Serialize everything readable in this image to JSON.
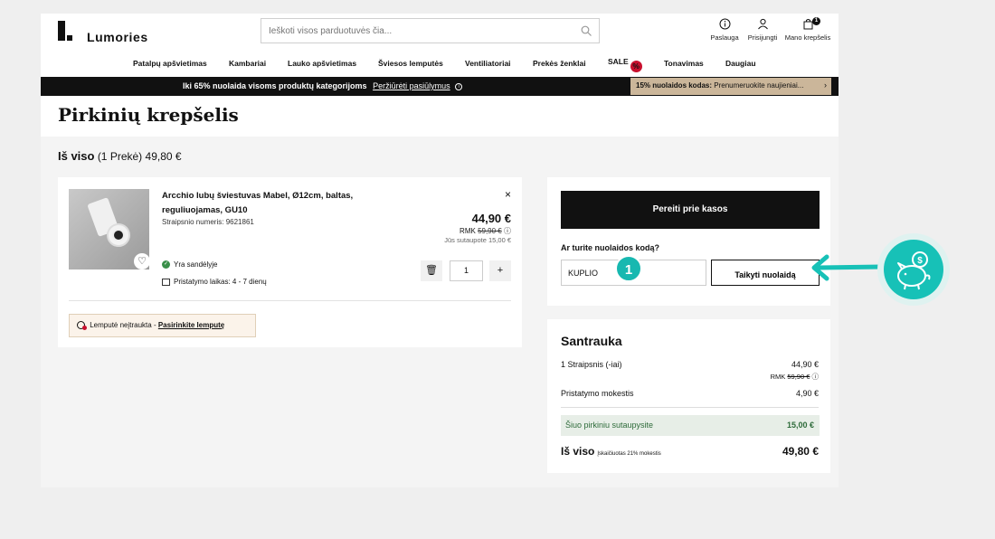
{
  "header": {
    "logo": "Lumories",
    "search_placeholder": "Ieškoti visos parduotuvės čia...",
    "icons": [
      {
        "name": "info-icon",
        "label": "Paslauga"
      },
      {
        "name": "user-icon",
        "label": "Prisijungti"
      },
      {
        "name": "bag-icon",
        "label": "Mano krepšelis",
        "badge": "1"
      }
    ]
  },
  "nav": [
    "Patalpų apšvietimas",
    "Kambariai",
    "Lauko apšvietimas",
    "Šviesos lemputės",
    "Ventiliatoriai",
    "Prekės ženklai",
    "SALE",
    "Tonavimas",
    "Daugiau"
  ],
  "sale_badge": "%",
  "promo": {
    "message": "Iki 65% nuolaida visoms produktų kategorijoms",
    "link": "Peržiūrėti pasiūlymus",
    "code_label": "15% nuolaidos kodas:",
    "code_text": "Prenumeruokite naujieniai...",
    "code_arrow": "›"
  },
  "page_title": "Pirkinių krepšelis",
  "total": {
    "label": "Iš viso",
    "count": "(1 Prekė)",
    "amount": "49,80 €"
  },
  "cart_item": {
    "name": "Arcchio lubų šviestuvas Mabel, Ø12cm, baltas, reguliuojamas, GU10",
    "sku": "Straipsnio numeris: 9621861",
    "price": "44,90 €",
    "rmk_label": "RMK",
    "rmk_price": "59,90 €",
    "savings": "Jūs sutaupote 15,00 €",
    "stock": "Yra sandėlyje",
    "delivery": "Pristatymo laikas: 4 - 7 dienų",
    "quantity": "1",
    "remove": "×",
    "minus": "🗑",
    "plus": "+",
    "bulb_note": "Lemputė neįtraukta -",
    "bulb_link": "Pasirinkite lemputę"
  },
  "checkout": {
    "button": "Pereiti prie kasos",
    "discount_question": "Ar turite nuolaidos kodą?",
    "discount_value": "KUPLIO",
    "apply_button": "Taikyti nuolaidą",
    "step": "1"
  },
  "summary": {
    "title": "Santrauka",
    "items_label": "1 Straipsnis (-iai)",
    "items_price": "44,90 €",
    "items_rmk": "RMK",
    "items_rmk_price": "59,90 €",
    "delivery_label": "Pristatymo mokestis",
    "delivery_price": "4,90 €",
    "savings_label": "Šiuo pirkiniu sutaupysite",
    "savings_value": "15,00 €",
    "total_label": "Iš viso",
    "total_note": "Įskaičiuotas 21% mokestis",
    "total_value": "49,80 €"
  },
  "colors": {
    "accent": "#17c1b7",
    "dark": "#111111",
    "promo_code_bg": "#cbb69a",
    "sale": "#c8102e"
  }
}
